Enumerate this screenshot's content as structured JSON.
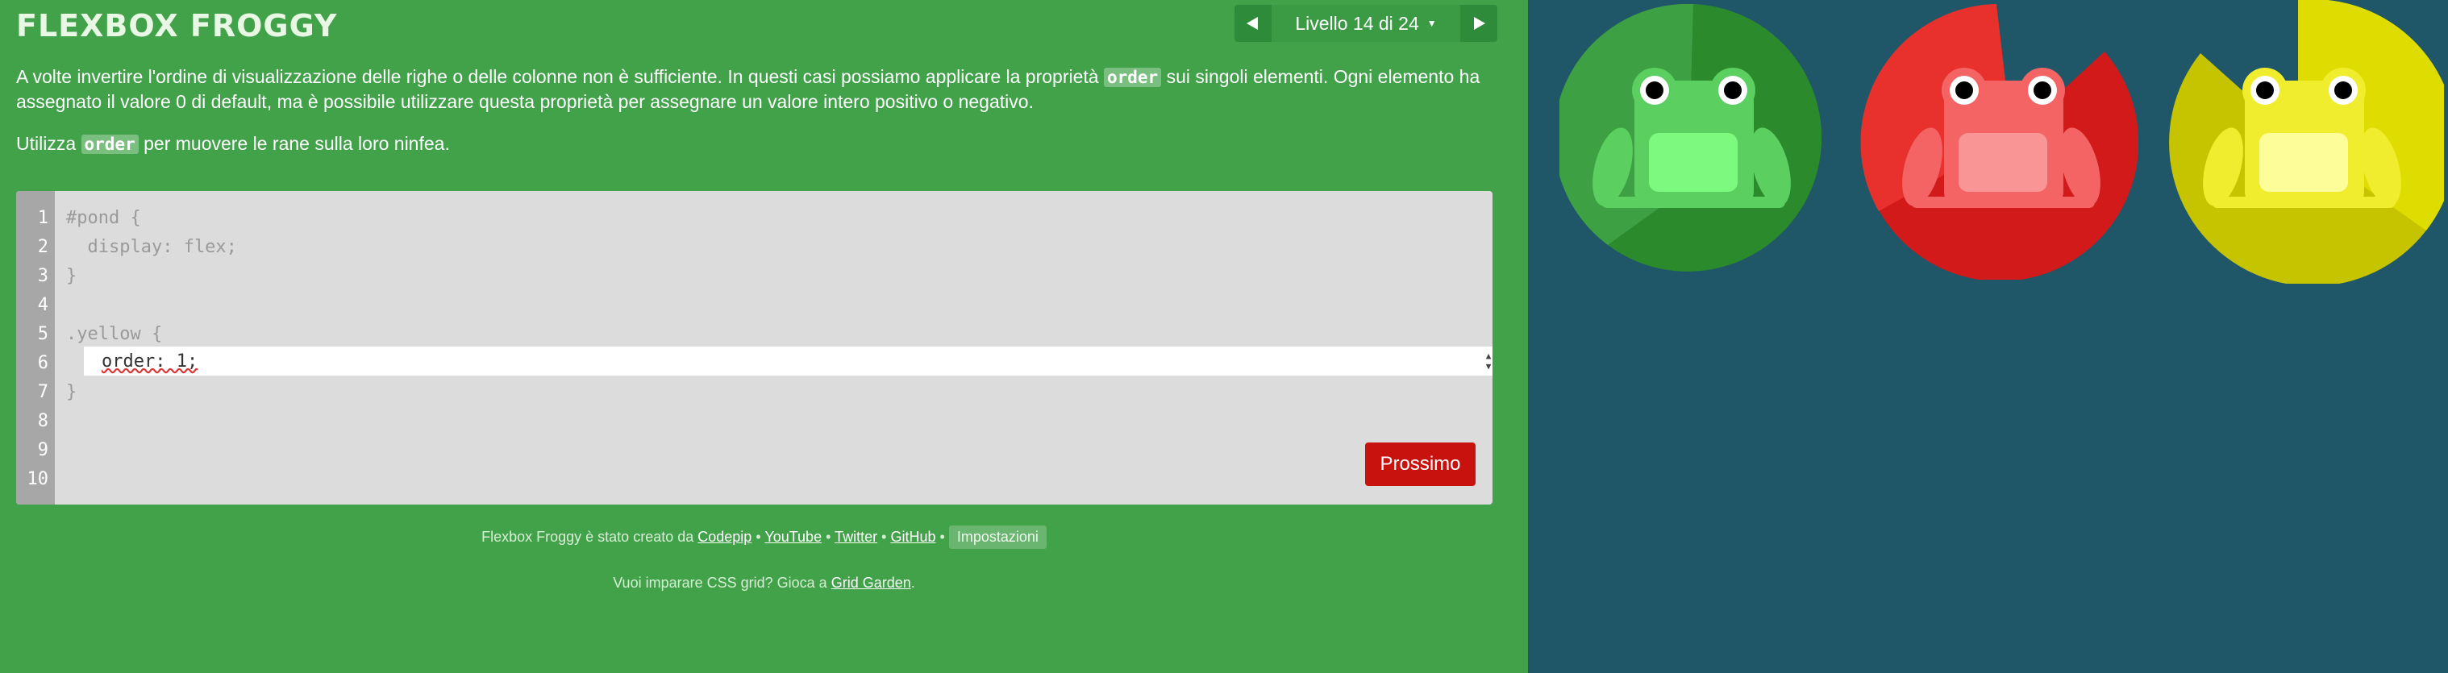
{
  "app": {
    "title": "FLEXBOX FROGGY"
  },
  "level_nav": {
    "level_label": "Livello 14 di 24",
    "prev_icon": "triangle-left-icon",
    "next_icon": "triangle-right-icon",
    "dropdown_icon": "caret-down-icon"
  },
  "instructions": {
    "p1_before": "A volte invertire l'ordine di visualizzazione delle righe o delle colonne non è sufficiente. In questi casi possiamo applicare la proprietà",
    "p1_keyword": "order",
    "p1_after": "sui singoli elementi. Ogni elemento ha assegnato il valore 0 di default, ma è possibile utilizzare questa proprietà per assegnare un valore intero positivo o negativo.",
    "p2_before": "Utilizza",
    "p2_keyword": "order",
    "p2_after": "per muovere le rane sulla loro ninfea."
  },
  "editor": {
    "line_numbers": [
      "1",
      "2",
      "3",
      "4",
      "5",
      "6",
      "7",
      "8",
      "9",
      "10"
    ],
    "line1": "#pond {",
    "line2": "  display: flex;",
    "line3": "}",
    "line5": ".yellow {",
    "answer_value": "order: 1;",
    "line7": "}",
    "next_label": "Prossimo"
  },
  "credits": {
    "prefix": "Flexbox Froggy è stato creato da",
    "link_codepip": "Codepip",
    "sep": "•",
    "link_youtube": "YouTube",
    "link_twitter": "Twitter",
    "link_github": "GitHub",
    "settings_label": "Impostazioni"
  },
  "promo": {
    "prefix": "Vuoi imparare CSS grid? Gioca a",
    "link": "Grid Garden",
    "suffix": "."
  },
  "colors": {
    "sidebar_bg": "#41a24a",
    "pond_bg": "#1f5768",
    "next_button": "#c8120e",
    "frog_green": "#5bcf5f",
    "frog_red": "#f46465",
    "frog_yellow": "#f0ed2f",
    "lilypad_green": "#2b8a2c",
    "lilypad_red": "#d21a1a",
    "lilypad_yellow": "#c6c400"
  },
  "pond": {
    "frogs": [
      {
        "color": "green",
        "icon": "frog-icon"
      },
      {
        "color": "red",
        "icon": "frog-icon"
      },
      {
        "color": "yellow",
        "icon": "frog-icon"
      }
    ],
    "lilypad_icon": "lilypad-icon"
  }
}
